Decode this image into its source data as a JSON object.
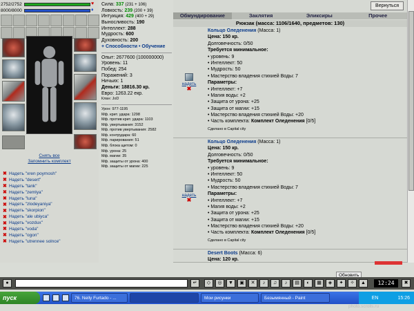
{
  "hp": {
    "text": "2752/2752",
    "fill": 1.0,
    "color": "#1ea61e"
  },
  "mana": {
    "text": "8000/8000",
    "fill": 1.0,
    "color": "#2250c8"
  },
  "stats": {
    "strength": {
      "label": "Сила:",
      "value": "337",
      "extra": "(231 + 106)"
    },
    "agility": {
      "label": "Ловкость:",
      "value": "239",
      "extra": "(200 + 39)"
    },
    "intuition": {
      "label": "Интуиция:",
      "value": "429",
      "extra": "(400 + 29)"
    },
    "endurance": {
      "label": "Выносливость:",
      "value": "190"
    },
    "intellect": {
      "label": "Интеллект:",
      "value": "288"
    },
    "wisdom": {
      "label": "Мудрость:",
      "value": "600"
    },
    "spirit": {
      "label": "Духовность:",
      "value": "200"
    },
    "abilities_link": "Способности • Обучение",
    "exp": "Опыт: 2677600 (100000000)",
    "level": "Уровень: 11",
    "wins": "Побед: 254",
    "losses": "Поражений: 3",
    "draws": "Ничьих: 1",
    "money": "Деньги: 18816.30 кр.",
    "euro": "Евро: 1263.22 екр.",
    "clan": "Клан: JoD",
    "damage": "Урон: 977-1195",
    "mf1": "Мф. крит. удара: 1298",
    "mf2": "Мф. против крит. удара: 1103",
    "mf3": "Мф. увертывания: 3152",
    "mf4": "Мф. против увертывания: 2582",
    "mf5": "Мф. контрудара: 60",
    "mf6": "Мф. парирования: 51",
    "mf7": "Мф. блока щитом: 0",
    "mf8": "Мф. урона: 25",
    "mf9": "Мф. магии: 35",
    "mf10": "Мф. защиты от урона: 400",
    "mf11": "Мф. защиты от магии: 225"
  },
  "left_links": {
    "remove_all": "Снять все",
    "remember": "Запомнить комплект"
  },
  "find_list": [
    "Надеть \"xren poymosh\"",
    "Надеть \"desert\"",
    "Надеть \"tank\"",
    "Надеть \"zemlya\"",
    "Надеть \"luna\"",
    "Надеть \"zlodeyaniya\"",
    "Надеть \"skorpion\"",
    "Надеть \"ale ubiyca\"",
    "Надеть \"vozdux\"",
    "Надеть \"voda\"",
    "Надеть \"ogon\"",
    "Надеть \"utrennee solnce\""
  ],
  "inventory": {
    "back_button": "Вернуться",
    "tabs": [
      "Обмундирование",
      "Заклятия",
      "Эликсиры",
      "Прочее"
    ],
    "bag_title": "Рюкзак (масса: 1106/1640, предметов: 130)",
    "put_on": "надеть",
    "items": [
      {
        "title": "Кольцо Оледенения",
        "mass": "(Масса: 1)",
        "price": "Цена: 150 кр.",
        "durability": "Долговечность: 0/50",
        "req_title": "Требуется минимальное:",
        "reqs": [
          "• уровень: 9",
          "• Интеллект: 50",
          "• Мудрость: 50",
          "• Мастерство владения стихией Воды: 7"
        ],
        "params_title": "Параметры:",
        "params": [
          "• Интеллект: +7",
          "• Магия воды: +2",
          "• Защита от урона: +25",
          "• Защита от магии: +15",
          "• Мастерство владения стихией Воды: +20"
        ],
        "set_prefix": "• Часть комплекта:",
        "set_name": "Комплект Оледенения",
        "set_count": "[0/5]",
        "made": "Сделано в Capital city"
      },
      {
        "title": "Кольцо Оледенения",
        "mass": "(Масса: 1)",
        "price": "Цена: 150 кр.",
        "durability": "Долговечность: 0/50",
        "req_title": "Требуется минимальное:",
        "reqs": [
          "• уровень: 9",
          "• Интеллект: 50",
          "• Мудрость: 50",
          "• Мастерство владения стихией Воды: 7"
        ],
        "params_title": "Параметры:",
        "params": [
          "• Интеллект: +7",
          "• Магия воды: +2",
          "• Защита от урона: +25",
          "• Защита от магии: +15",
          "• Мастерство владения стихией Воды: +20"
        ],
        "set_prefix": "• Часть комплекта:",
        "set_name": "Комплект Оледенения",
        "set_count": "[0/5]",
        "made": "Сделано в Capital city"
      },
      {
        "title": "Desert Boots",
        "mass": "(Масса: 6)",
        "price": "Цена: 120 кр."
      }
    ]
  },
  "chat": {
    "refresh": "Обновить",
    "time": "12:24"
  },
  "taskbar": {
    "start": "пуск",
    "tasks": [
      "76. Nelly Furtado - ...",
      "",
      "Мои рисунки",
      "Безымянный - Paint"
    ],
    "lang": "EN",
    "clock": "15:26"
  },
  "watermark": "photo.scrolls.ru"
}
